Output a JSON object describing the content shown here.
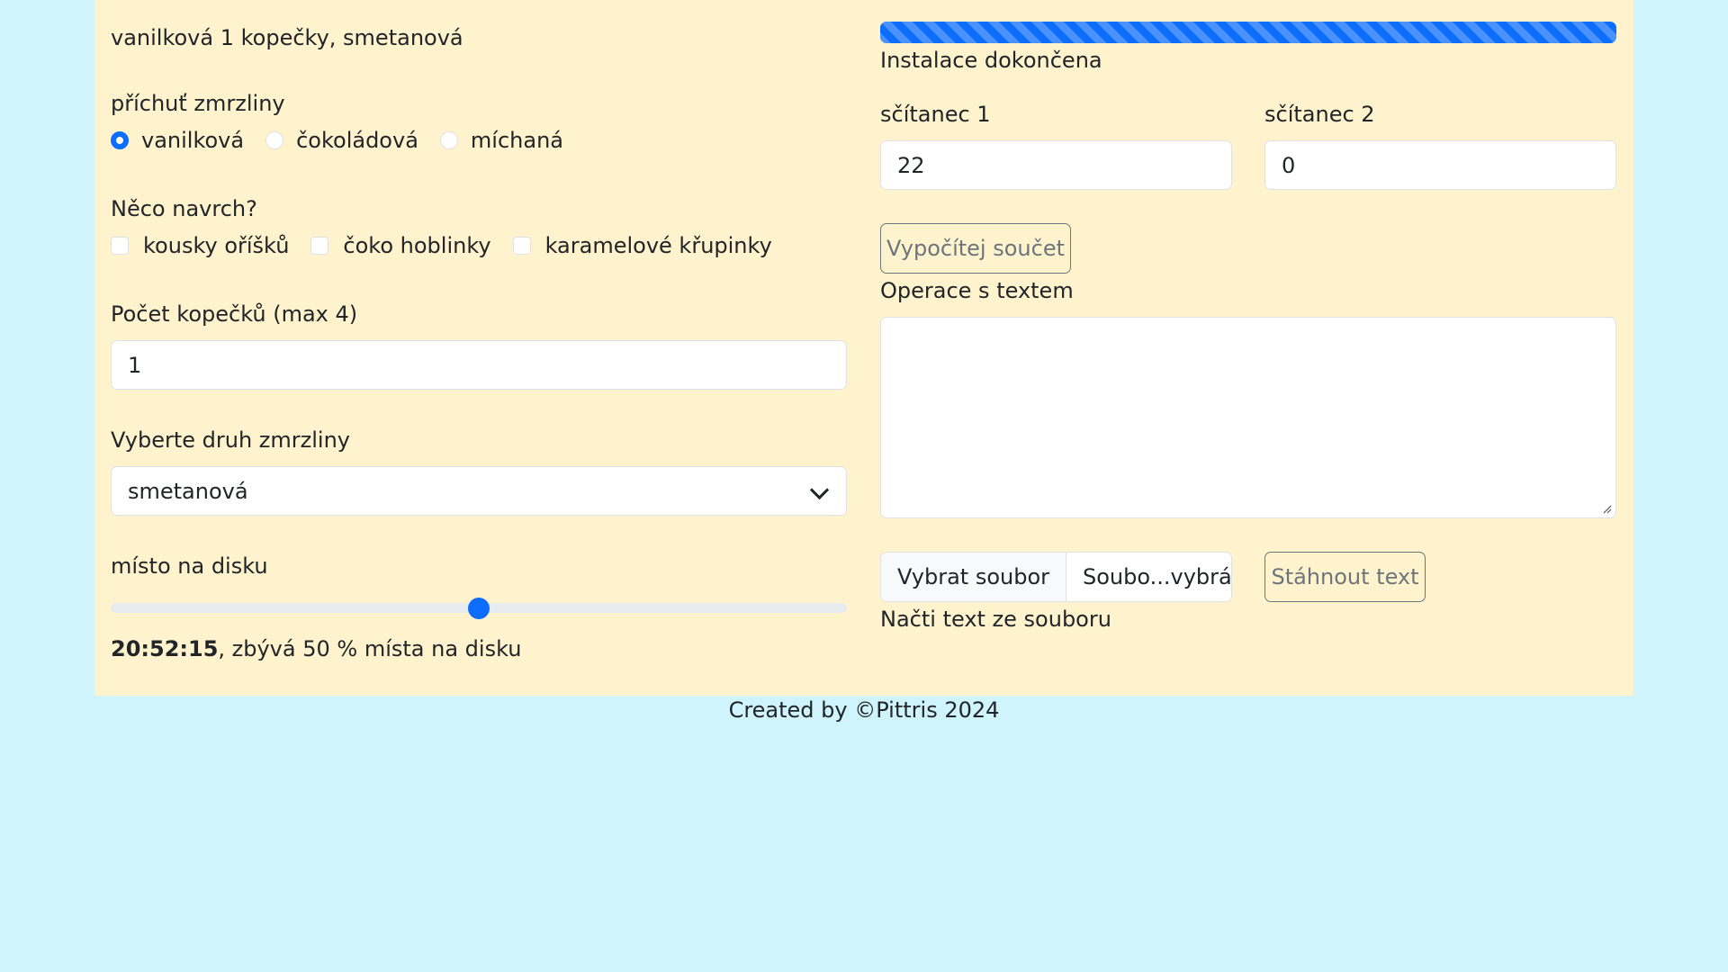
{
  "summary": "vanilková 1 kopečky, smetanová",
  "flavor": {
    "label": "příchuť zmrzliny",
    "options": [
      "vanilková",
      "čokoládová",
      "míchaná"
    ],
    "selected": "vanilková"
  },
  "toppings": {
    "label": "Něco navrch?",
    "options": [
      "kousky oříšků",
      "čoko hoblinky",
      "karamelové křupinky"
    ],
    "checked": []
  },
  "scoops": {
    "label": "Počet kopečků (max 4)",
    "value": "1"
  },
  "icecream_type": {
    "label": "Vyberte druh zmrzliny",
    "selected": "smetanová"
  },
  "disk": {
    "label": "místo na disku",
    "slider_value": 50,
    "time": "20:52:15",
    "status_suffix": ", zbývá 50 % místa na disku"
  },
  "install": {
    "progress": 100,
    "status": "Instalace dokončena"
  },
  "addend1": {
    "label": "sčítanec 1",
    "value": "22"
  },
  "addend2": {
    "label": "sčítanec 2",
    "value": "0"
  },
  "calc_button": "Vypočítej součet",
  "text_ops": {
    "label": "Operace s textem",
    "value": ""
  },
  "file": {
    "choose_label": "Vybrat soubor",
    "filename": "Soubo...vybrán",
    "load_label": "Načti text ze souboru"
  },
  "download_button": "Stáhnout text",
  "footer": "Created by ©Pittris 2024",
  "colors": {
    "page_bg": "#cff4fb",
    "panel_bg": "#fff3cd",
    "accent": "#0d6efd"
  }
}
